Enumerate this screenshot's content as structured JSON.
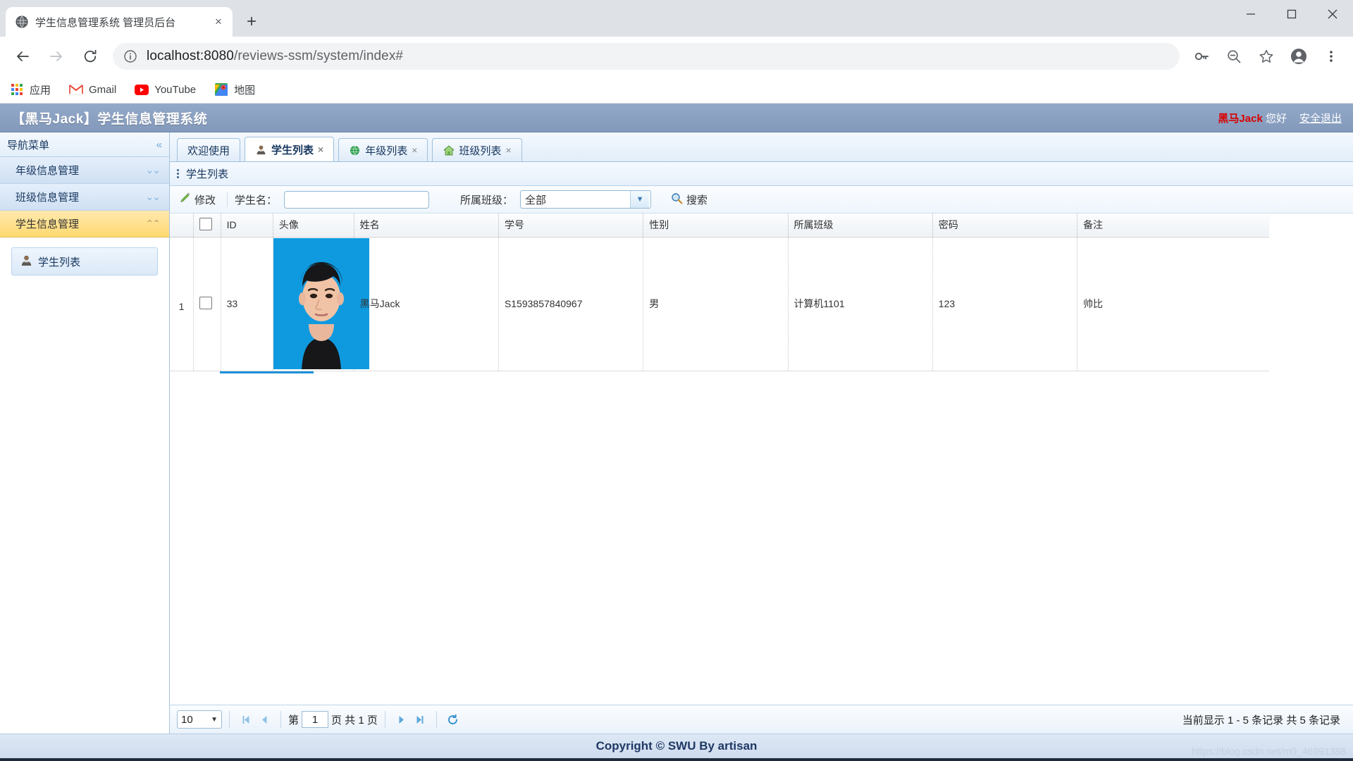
{
  "browser": {
    "tab_title": "学生信息管理系统 管理员后台",
    "tab_close": "×",
    "new_tab": "+",
    "window_minimize": "—",
    "window_maximize": "▢",
    "window_close": "✕",
    "back": "←",
    "forward": "→",
    "reload": "⟳",
    "url_host": "localhost:8080",
    "url_path": "/reviews-ssm/system/index#",
    "bookmarks": [
      {
        "label": "应用",
        "icon": "apps-grid-icon"
      },
      {
        "label": "Gmail",
        "icon": "gmail-icon"
      },
      {
        "label": "YouTube",
        "icon": "youtube-icon"
      },
      {
        "label": "地图",
        "icon": "maps-icon"
      }
    ],
    "toolbar_icons": [
      "key-icon",
      "zoom-out-icon",
      "star-icon",
      "profile-icon",
      "menu-kebab-icon"
    ]
  },
  "app_header": {
    "brand": "【黑马Jack】学生信息管理系统",
    "username": "黑马Jack",
    "greeting": "您好",
    "logout": "安全退出",
    "username_color": "#d80000",
    "bar_color": "#8ba2c4"
  },
  "sidebar": {
    "title": "导航菜单",
    "collapse_icon": "«",
    "items": [
      {
        "label": "年级信息管理",
        "chevron": "⌄⌄",
        "active": false
      },
      {
        "label": "班级信息管理",
        "chevron": "⌄⌄",
        "active": false
      },
      {
        "label": "学生信息管理",
        "chevron": "⌃⌃",
        "active": true
      }
    ],
    "leaf": {
      "label": "学生列表",
      "icon": "student-avatar-icon"
    }
  },
  "tabs": [
    {
      "label": "欢迎使用",
      "closable": false,
      "selected": false,
      "icon": null
    },
    {
      "label": "学生列表",
      "closable": true,
      "selected": true,
      "icon": "student-avatar-icon",
      "close": "×"
    },
    {
      "label": "年级列表",
      "closable": true,
      "selected": false,
      "icon": "globe-icon",
      "close": "×"
    },
    {
      "label": "班级列表",
      "closable": true,
      "selected": false,
      "icon": "home-icon",
      "close": "×"
    }
  ],
  "panel": {
    "title": "学生列表",
    "toolbar": {
      "edit_label": "修改",
      "edit_icon": "pencil-icon",
      "name_label": "学生名：",
      "name_value": "",
      "name_placeholder": "",
      "class_label": "所属班级：",
      "class_selected": "全部",
      "class_options": [
        "全部"
      ],
      "search_label": "搜索",
      "search_icon": "magnifier-icon"
    },
    "table": {
      "columns": [
        "",
        "ID",
        "头像",
        "姓名",
        "学号",
        "性别",
        "所属班级",
        "密码",
        "备注"
      ],
      "rows": [
        {
          "no": "1",
          "id": "33",
          "avatar_alt": "student-photo",
          "name": "黑马Jack",
          "student_no": "S1593857840967",
          "gender": "男",
          "class": "计算机1101",
          "password": "123",
          "remark": "帅比"
        }
      ]
    },
    "pager": {
      "page_size": "10",
      "first_icon": "⏮",
      "prev_icon": "◀",
      "page_prefix": "第",
      "page_value": "1",
      "page_suffix": "页 共 1 页",
      "next_icon": "▶",
      "last_icon": "⏭",
      "refresh_icon": "↻",
      "info": "当前显示 1 - 5 条记录 共 5 条记录"
    }
  },
  "footer": {
    "copyright": "Copyright © SWU By artisan",
    "watermark": "https://blog.csdn.net/m0_46991388"
  }
}
